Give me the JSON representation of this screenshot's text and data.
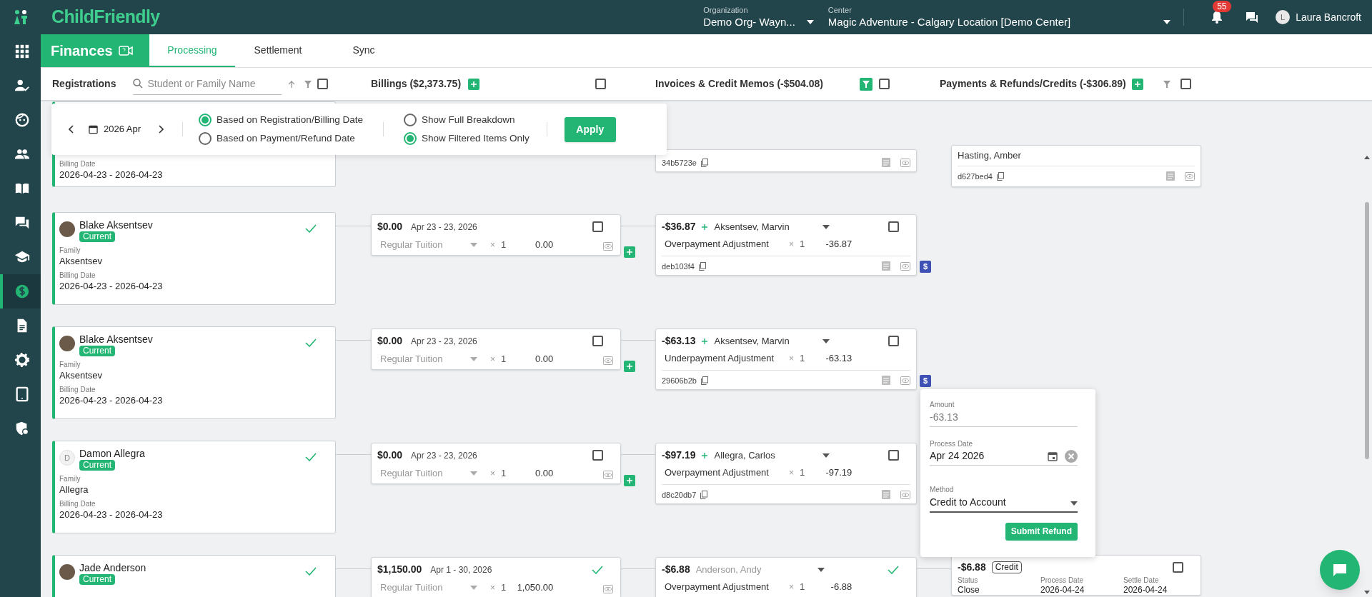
{
  "top_bar": {
    "logo": "ChildFriendly",
    "organization": {
      "label": "Organization",
      "value": "Demo Org- Wayn..."
    },
    "center": {
      "label": "Center",
      "value": "Magic Adventure - Calgary Location [Demo Center]"
    },
    "notifications": "55",
    "user": {
      "initial": "L",
      "name": "Laura Bancroft"
    }
  },
  "sidebar": {
    "items": [
      {
        "selected": false
      },
      {
        "selected": false
      },
      {
        "selected": false
      },
      {
        "selected": false
      },
      {
        "selected": false
      },
      {
        "selected": false
      },
      {
        "selected": false
      },
      {
        "selected": true
      },
      {
        "selected": false
      },
      {
        "selected": false
      },
      {
        "selected": false
      },
      {
        "selected": false
      }
    ]
  },
  "module": {
    "title": "Finances",
    "tabs": [
      {
        "label": "Processing",
        "selected": true
      },
      {
        "label": "Settlement",
        "selected": false
      },
      {
        "label": "Sync",
        "selected": false
      }
    ]
  },
  "columns": [
    {
      "kind": "registrations",
      "title": "Registrations",
      "search_placeholder": "Student or Family Name",
      "filter_active": false,
      "checked": false
    },
    {
      "kind": "billings",
      "title": "Billings ($2,373.75)",
      "add": true,
      "checked": false
    },
    {
      "kind": "invoices",
      "title": "Invoices & Credit Memos (-$504.08)",
      "filter_active": true,
      "checked": false
    },
    {
      "kind": "payments",
      "title": "Payments & Refunds/Credits (-$306.89)",
      "add": true,
      "filter_active": false,
      "checked": false
    }
  ],
  "date_filter": {
    "period": "2026 Apr",
    "basis": [
      {
        "label": "Based on Registration/Billing Date",
        "selected": true
      },
      {
        "label": "Based on Payment/Refund Date",
        "selected": false
      }
    ],
    "display": [
      {
        "label": "Show Full Breakdown",
        "selected": false
      },
      {
        "label": "Show Filtered Items Only",
        "selected": true
      }
    ],
    "apply": "Apply"
  },
  "rows": [
    {
      "registration": {
        "billing_date_label": "Billing Date",
        "billing_date": "2026-04-23 - 2026-04-23"
      },
      "invoice": {
        "id": "34b5723e"
      },
      "payment": {
        "name": "Hasting, Amber",
        "id": "d627bed4"
      }
    },
    {
      "registration": {
        "avatar": {
          "kind": "photo"
        },
        "name": "Blake Aksentsev",
        "status": "Current",
        "verified": true,
        "family_label": "Family",
        "family": "Aksentsev",
        "billing_date_label": "Billing Date",
        "billing_date": "2026-04-23 - 2026-04-23"
      },
      "billing": {
        "amount": "$0.00",
        "period": "Apr 23 - 23, 2026",
        "item": "Regular Tuition",
        "times": "×",
        "quantity": "1",
        "total": "0.00",
        "control": {
          "kind": "checkbox",
          "checked": false
        },
        "add": true
      },
      "invoice": {
        "amount": "-$36.87",
        "payer": "Aksentsev, Marvin",
        "payer_editable": true,
        "item": "Overpayment Adjustment",
        "times": "×",
        "quantity": "1",
        "total": "-36.87",
        "id": "deb103f4",
        "control": {
          "kind": "checkbox",
          "checked": false
        },
        "refund_badge": "$"
      }
    },
    {
      "registration": {
        "avatar": {
          "kind": "photo"
        },
        "name": "Blake Aksentsev",
        "status": "Current",
        "verified": true,
        "family_label": "Family",
        "family": "Aksentsev",
        "billing_date_label": "Billing Date",
        "billing_date": "2026-04-23 - 2026-04-23"
      },
      "billing": {
        "amount": "$0.00",
        "period": "Apr 23 - 23, 2026",
        "item": "Regular Tuition",
        "times": "×",
        "quantity": "1",
        "total": "0.00",
        "control": {
          "kind": "checkbox",
          "checked": false
        },
        "add": true
      },
      "invoice": {
        "amount": "-$63.13",
        "payer": "Aksentsev, Marvin",
        "payer_editable": true,
        "item": "Underpayment Adjustment",
        "times": "×",
        "quantity": "1",
        "total": "-63.13",
        "id": "29606b2b",
        "control": {
          "kind": "checkbox",
          "checked": false
        },
        "refund_badge": "$"
      },
      "refund_form": {
        "amount": {
          "label": "Amount",
          "value": "-63.13"
        },
        "process_date": {
          "label": "Process Date",
          "value": "Apr 24 2026"
        },
        "method": {
          "label": "Method",
          "value": "Credit to Account"
        },
        "submit": "Submit Refund"
      }
    },
    {
      "registration": {
        "avatar": {
          "kind": "initial",
          "initial": "D"
        },
        "name": "Damon Allegra",
        "status": "Current",
        "verified": true,
        "family_label": "Family",
        "family": "Allegra",
        "billing_date_label": "Billing Date",
        "billing_date": "2026-04-23 - 2026-04-23"
      },
      "billing": {
        "amount": "$0.00",
        "period": "Apr 23 - 23, 2026",
        "item": "Regular Tuition",
        "times": "×",
        "quantity": "1",
        "total": "0.00",
        "control": {
          "kind": "checkbox",
          "checked": false
        },
        "add": true
      },
      "invoice": {
        "amount": "-$97.19",
        "payer": "Allegra, Carlos",
        "payer_editable": true,
        "item": "Overpayment Adjustment",
        "times": "×",
        "quantity": "1",
        "total": "-97.19",
        "id": "d8c20db7",
        "control": {
          "kind": "checkbox",
          "checked": false
        }
      }
    },
    {
      "registration": {
        "avatar": {
          "kind": "photo"
        },
        "name": "Jade Anderson",
        "status": "Current",
        "verified": true
      },
      "billing": {
        "amount": "$1,150.00",
        "period": "Apr 1 - 30, 2026",
        "item": "Regular Tuition",
        "times": "×",
        "quantity": "1",
        "total": "1,050.00",
        "control": {
          "kind": "check"
        }
      },
      "invoice": {
        "amount": "-$6.88",
        "payer": "Anderson, Andy",
        "payer_editable": false,
        "item": "Overpayment Adjustment",
        "times": "×",
        "quantity": "1",
        "total": "-6.88",
        "control": {
          "kind": "check"
        }
      },
      "payment": {
        "amount": "-$6.88",
        "tag": "Credit",
        "fields": [
          {
            "label": "Status",
            "value": "Close"
          },
          {
            "label": "Process Date",
            "value": "2026-04-24"
          },
          {
            "label": "Settle Date",
            "value": "2026-04-24"
          }
        ],
        "control": {
          "kind": "checkbox",
          "checked": false
        }
      }
    }
  ]
}
